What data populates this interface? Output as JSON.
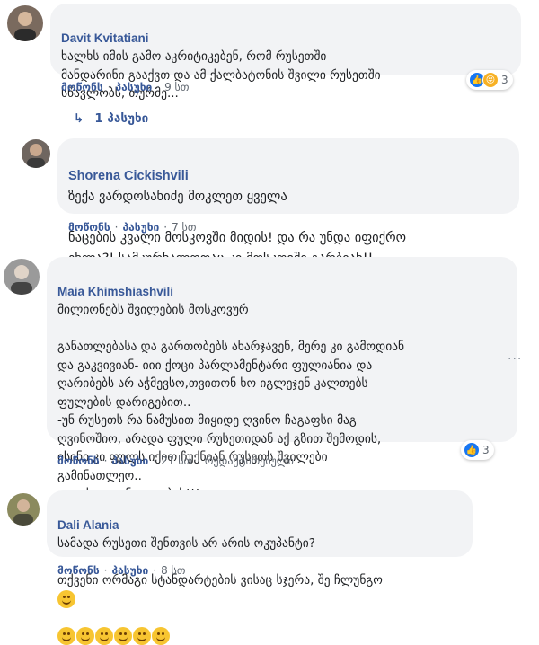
{
  "comments": [
    {
      "author": "Davit Kvitatiani",
      "text": "ხალხს იმის გამო აკრიტიკებენ, რომ რუსეთში\nმანდარინი გააქვთ და ამ ქალბატონის შვილი რუსეთში\nსწავლობს, თურმე...",
      "like": "მოწონს",
      "reply": "პასუხი",
      "time": "9 სთ",
      "reaction_count": "3"
    },
    {
      "author": "Shorena Cickishvili",
      "text_first": "ზექა ვარდოსანიძე მოკლეთ ყველა",
      "text": "ნაცების კვალი მოსკოვში მიდის! და რა უნდა იფიქრო\nეხლა?! სამკურნალოთაც კი მოსკოვში გარბიან!!",
      "like": "მოწონს",
      "reply": "პასუხი",
      "time": "7 სთ"
    },
    {
      "author": "Maia Khimshiashvili",
      "text_first": "მილიონებს შვილების მოსკოვურ",
      "text": "განათლებასა და გართობებს ახარჯავენ, მერე კი გამოდიან\nდა გაკვივიან- იიი ქოცი პარლამენტარი ფულიანია და\nღარიბებს არ აჭმევსო,თვითონ ხო იგლეჯენ კალთებს\nფულების დარიგებით..\n-უნ რუსეთს რა ნამუსით მიყიდე ღვინო ჩაგაფსი მაგ\nღვინოშიო, არადა ფული რუსეთიდან აქ გზით შემოდის,\nისინი კი ფულს იქით ჩუქნიან რუსეთს შვილები\nგამინათლეო..\nვაი ასეთ განათლებას!!!",
      "like": "მოწონს",
      "reply": "პასუხი",
      "time": "21 სთ",
      "edited": "რედაქტირებული",
      "reaction_count": "3"
    },
    {
      "author": "Dali Alania",
      "text_first": "სამადა რუსეთი შენთვის არ არის ოკუპანტი?",
      "text": "თქვენი ორმაგი სტანდარტების ვისაც სჯერა, შე ჩლუნგო",
      "like": "მოწონს",
      "reply": "პასუხი",
      "time": "8 სთ"
    }
  ],
  "replies_label": "1 პასუხი",
  "more_options": "···",
  "icons": {
    "like": "like-reaction-icon",
    "haha": "haha-reaction-icon",
    "reply_arrow": "reply-arrow-icon"
  },
  "colors": {
    "author": "#385898",
    "bubble": "#f2f3f5",
    "meta": "#606770",
    "like_blue": "#1877f2"
  }
}
